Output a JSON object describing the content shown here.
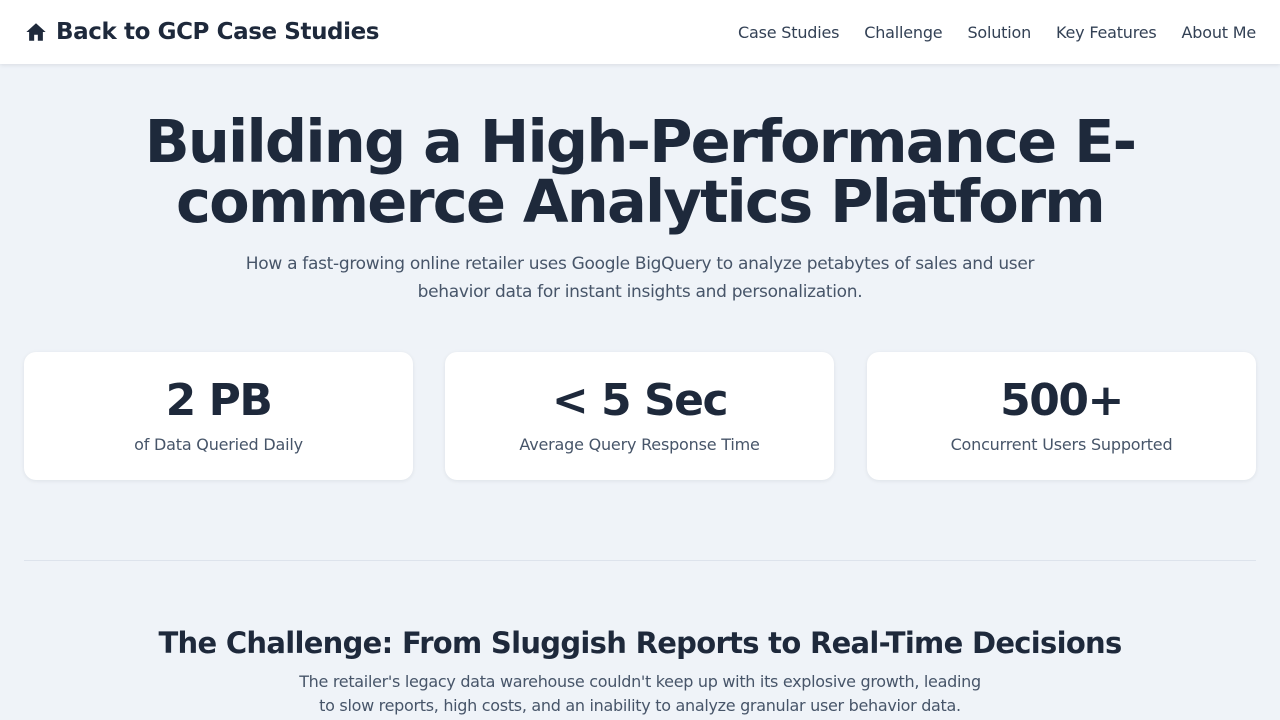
{
  "nav": {
    "brand_label": "Back to GCP Case Studies",
    "brand_icon": "home-icon",
    "links": [
      "Case Studies",
      "Challenge",
      "Solution",
      "Key Features",
      "About Me"
    ]
  },
  "hero": {
    "title": "Building a High-Performance E-commerce Analytics Platform",
    "subtitle": "How a fast-growing online retailer uses Google BigQuery to analyze petabytes of sales and user behavior data for instant insights and personalization."
  },
  "stats": [
    {
      "value": "2 PB",
      "label": "of Data Queried Daily"
    },
    {
      "value": "< 5 Sec",
      "label": "Average Query Response Time"
    },
    {
      "value": "500+",
      "label": "Concurrent Users Supported"
    }
  ],
  "challenge": {
    "title": "The Challenge: From Sluggish Reports to Real-Time Decisions",
    "text": "The retailer's legacy data warehouse couldn't keep up with its explosive growth, leading to slow reports, high costs, and an inability to analyze granular user behavior data."
  },
  "colors": {
    "background": "#eff3f8",
    "text": "#1e293b",
    "muted": "#475569",
    "card": "#ffffff"
  }
}
